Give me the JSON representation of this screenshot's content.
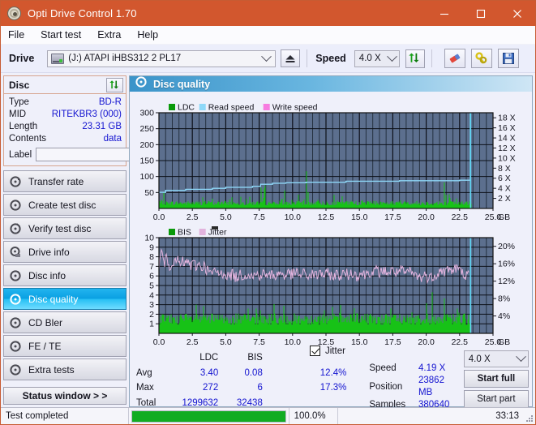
{
  "window": {
    "title": "Opti Drive Control 1.70",
    "app_icon": "disc-icon",
    "minimize": "minimize-icon",
    "maximize": "maximize-icon",
    "close": "close-icon"
  },
  "menu": [
    {
      "label": "File"
    },
    {
      "label": "Start test"
    },
    {
      "label": "Extra"
    },
    {
      "label": "Help"
    }
  ],
  "toolbar": {
    "drive_label": "Drive",
    "drive_value": "(J:)  ATAPI iHBS312  2 PL17",
    "eject": "eject-icon",
    "speed_label": "Speed",
    "speed_value": "4.0 X",
    "refresh": "refresh-icon",
    "erase": "eraser-icon",
    "tools": "wrench-icon",
    "save": "floppy-save-icon"
  },
  "disc_panel": {
    "title": "Disc",
    "refresh_icon": "refresh-icon",
    "rows": [
      {
        "key": "Type",
        "value": "BD-R"
      },
      {
        "key": "MID",
        "value": "RITEKBR3 (000)"
      },
      {
        "key": "Length",
        "value": "23.31 GB"
      },
      {
        "key": "Contents",
        "value": "data"
      }
    ],
    "label_key": "Label",
    "label_value": "",
    "label_placeholder": "",
    "label_button_icon": "disc-icon"
  },
  "nav": {
    "items": [
      {
        "label": "Transfer rate",
        "icon": "disc-arrow-icon",
        "active": false
      },
      {
        "label": "Create test disc",
        "icon": "disc-icon",
        "active": false
      },
      {
        "label": "Verify test disc",
        "icon": "disc-check-icon",
        "active": false
      },
      {
        "label": "Drive info",
        "icon": "drive-icon",
        "active": false
      },
      {
        "label": "Disc info",
        "icon": "disc-info-icon",
        "active": false
      },
      {
        "label": "Disc quality",
        "icon": "disc-quality-icon",
        "active": true
      },
      {
        "label": "CD Bler",
        "icon": "disc-bler-icon",
        "active": false
      },
      {
        "label": "FE / TE",
        "icon": "disc-fete-icon",
        "active": false
      },
      {
        "label": "Extra tests",
        "icon": "disc-extra-icon",
        "active": false
      }
    ],
    "status_window_button": "Status window > >"
  },
  "panel": {
    "icon": "disc-quality-icon",
    "title": "Disc quality"
  },
  "chart_data": [
    {
      "type": "line",
      "name": "top-chart",
      "title": "",
      "legend": [
        {
          "label": "LDC",
          "color": "#0a9a0a"
        },
        {
          "label": "Read speed",
          "color": "#8ed8f8"
        },
        {
          "label": "Write speed",
          "color": "#f77ce0"
        }
      ],
      "legend_position": "top-left",
      "xlabel": "GB",
      "x_ticks": [
        "0.0",
        "2.5",
        "5.0",
        "7.5",
        "10.0",
        "12.5",
        "15.0",
        "17.5",
        "20.0",
        "22.5",
        "25.0"
      ],
      "xlim": [
        0,
        25
      ],
      "ylabel_left": "LDC",
      "y_ticks_left": [
        "300",
        "250",
        "200",
        "150",
        "100",
        "50"
      ],
      "ylim_left": [
        0,
        300
      ],
      "ylabel_right": "Speed",
      "y_ticks_right": [
        "18 X",
        "16 X",
        "14 X",
        "12 X",
        "10 X",
        "8 X",
        "6 X",
        "4 X",
        "2 X"
      ],
      "ylim_right": [
        0,
        19
      ],
      "grid": true,
      "series": [
        {
          "name": "LDC",
          "color": "#17c217",
          "kind": "spikes",
          "baseline": 18,
          "x": [
            0.0,
            0.3,
            0.6,
            0.9,
            1.2,
            1.5,
            1.8,
            2.0,
            2.1,
            2.3,
            2.5,
            2.6,
            2.8,
            3.0,
            3.3,
            3.6,
            3.9,
            4.0,
            4.2,
            4.5,
            4.8,
            5.0,
            5.2,
            5.5,
            5.7,
            5.8,
            6.0,
            6.3,
            6.6,
            6.9,
            7.2,
            7.5,
            7.8,
            8.0,
            8.2,
            8.4,
            8.6,
            8.9,
            9.2,
            9.4,
            9.6,
            9.8,
            10.0,
            10.3,
            10.6,
            10.9,
            11.2,
            11.5,
            11.7,
            11.8,
            12.0,
            12.3,
            12.6,
            12.9,
            13.2,
            13.5,
            13.8,
            14.1,
            14.4,
            14.7,
            15.0,
            15.3,
            15.6,
            15.9,
            16.2,
            16.5,
            16.8,
            17.1,
            17.4,
            17.7,
            18.0,
            18.3,
            18.6,
            18.9,
            19.2,
            19.5,
            19.8,
            20.1,
            20.4,
            20.7,
            21.0,
            21.2,
            21.4,
            21.5,
            21.7,
            21.9,
            22.1,
            22.3,
            22.5,
            22.7,
            22.9,
            23.1,
            23.3
          ],
          "y": [
            22,
            55,
            30,
            26,
            40,
            30,
            100,
            78,
            34,
            80,
            28,
            36,
            30,
            124,
            30,
            34,
            28,
            55,
            26,
            40,
            30,
            50,
            28,
            152,
            44,
            36,
            30,
            44,
            28,
            40,
            26,
            72,
            60,
            188,
            40,
            60,
            34,
            50,
            40,
            176,
            50,
            36,
            40,
            58,
            30,
            44,
            172,
            68,
            40,
            36,
            44,
            30,
            52,
            36,
            44,
            30,
            40,
            34,
            46,
            30,
            38,
            44,
            30,
            40,
            36,
            30,
            44,
            56,
            40,
            104,
            60,
            70,
            44,
            50,
            30,
            40,
            66,
            44,
            90,
            120,
            168,
            130,
            200,
            150,
            96,
            70,
            120,
            56,
            160,
            90,
            60,
            40,
            120
          ]
        },
        {
          "name": "Read speed",
          "color": "#8ed8f8",
          "kind": "step",
          "x": [
            0.0,
            0.5,
            1.0,
            2.0,
            3.0,
            4.0,
            5.0,
            6.0,
            7.0,
            7.6,
            8.5,
            9.5,
            11.0,
            12.5,
            14.0,
            15.5,
            17.0,
            18.0,
            19.5,
            21.0,
            22.5,
            23.3,
            23.3
          ],
          "y": [
            3.2,
            3.6,
            3.6,
            3.8,
            3.8,
            4.0,
            4.2,
            4.2,
            4.4,
            4.8,
            5.0,
            5.1,
            5.2,
            5.2,
            5.4,
            5.4,
            5.4,
            5.5,
            5.5,
            5.5,
            5.6,
            5.6,
            19.0
          ]
        }
      ]
    },
    {
      "type": "line",
      "name": "bottom-chart",
      "title": "",
      "legend": [
        {
          "label": "BIS",
          "color": "#0a9a0a"
        },
        {
          "label": "Jitter",
          "color": "#e2b3dd"
        }
      ],
      "legend_position": "top-left",
      "xlabel": "GB",
      "x_ticks": [
        "0.0",
        "2.5",
        "5.0",
        "7.5",
        "10.0",
        "12.5",
        "15.0",
        "17.5",
        "20.0",
        "22.5",
        "25.0"
      ],
      "xlim": [
        0,
        25
      ],
      "ylabel_left": "BIS",
      "y_ticks_left": [
        "10",
        "9",
        "8",
        "7",
        "6",
        "5",
        "4",
        "3",
        "2",
        "1"
      ],
      "ylim_left": [
        0,
        10
      ],
      "ylabel_right": "Jitter",
      "y_ticks_right": [
        "20%",
        "16%",
        "12%",
        "8%",
        "4%"
      ],
      "ylim_right": [
        0,
        22
      ],
      "grid": true,
      "series": [
        {
          "name": "BIS",
          "color": "#17c217",
          "kind": "spikes",
          "baseline": 1.6,
          "x": [
            0.0,
            0.2,
            0.4,
            0.6,
            0.8,
            1.0,
            1.2,
            1.4,
            1.6,
            1.8,
            2.0,
            2.2,
            2.4,
            2.6,
            2.8,
            3.0,
            3.2,
            3.4,
            3.6,
            3.8,
            4.0,
            4.2,
            4.4,
            4.6,
            4.8,
            5.0,
            5.2,
            5.4,
            5.6,
            5.8,
            6.0,
            6.2,
            6.4,
            6.6,
            6.8,
            7.0,
            7.2,
            7.4,
            7.6,
            7.8,
            8.0,
            8.2,
            8.4,
            8.6,
            8.8,
            9.0,
            9.2,
            9.4,
            9.6,
            9.8,
            10.0,
            10.3,
            10.6,
            10.9,
            11.2,
            11.5,
            11.8,
            12.1,
            12.4,
            12.7,
            13.0,
            13.3,
            13.6,
            13.9,
            14.2,
            14.5,
            14.8,
            15.1,
            15.4,
            15.7,
            16.0,
            16.3,
            16.6,
            16.9,
            17.2,
            17.5,
            17.8,
            18.1,
            18.4,
            18.7,
            19.0,
            19.3,
            19.6,
            19.9,
            20.2,
            20.5,
            20.8,
            21.1,
            21.4,
            21.7,
            22.0,
            22.3,
            22.6,
            22.9,
            23.2
          ],
          "y": [
            2.2,
            1.9,
            1.4,
            2.8,
            2.6,
            1.9,
            2.4,
            3.0,
            2.2,
            4.1,
            2.6,
            3.0,
            2.2,
            2.6,
            3.0,
            2.0,
            2.4,
            3.0,
            2.2,
            2.6,
            2.2,
            2.4,
            3.0,
            2.2,
            2.8,
            3.0,
            2.4,
            3.2,
            5.1,
            3.3,
            2.9,
            2.6,
            3.0,
            2.4,
            2.8,
            2.6,
            2.2,
            3.0,
            2.4,
            2.8,
            2.2,
            4.1,
            2.6,
            3.2,
            2.4,
            2.6,
            2.2,
            3.0,
            2.6,
            2.4,
            2.8,
            2.2,
            3.0,
            2.6,
            2.4,
            2.8,
            2.2,
            3.0,
            2.4,
            2.6,
            2.8,
            2.2,
            3.0,
            2.6,
            2.4,
            2.8,
            5.1,
            2.2,
            2.6,
            3.0,
            2.4,
            2.8,
            3.3,
            2.6,
            3.0,
            2.4,
            2.8,
            2.6,
            3.0,
            3.4,
            3.0,
            2.6,
            3.0,
            2.8,
            3.4,
            4.3,
            3.2,
            4.9,
            3.6,
            5.0,
            3.4,
            4.9,
            3.4,
            3.0,
            2.8
          ]
        },
        {
          "name": "Jitter",
          "color": "#e2b3dd",
          "kind": "noisy",
          "x": [
            0.0,
            0.2,
            0.4,
            0.6,
            0.8,
            1.0,
            1.2,
            1.4,
            1.6,
            1.8,
            2.0,
            2.2,
            2.4,
            2.6,
            2.8,
            3.0,
            3.2,
            3.4,
            3.6,
            3.8,
            4.0,
            4.3,
            4.6,
            4.9,
            5.2,
            5.5,
            5.8,
            6.1,
            6.4,
            6.7,
            7.0,
            7.3,
            7.6,
            7.9,
            8.2,
            8.5,
            8.8,
            9.1,
            9.4,
            9.7,
            10.0,
            10.3,
            10.6,
            10.9,
            11.2,
            11.5,
            11.8,
            12.1,
            12.4,
            12.7,
            13.0,
            13.3,
            13.6,
            13.9,
            14.2,
            14.5,
            14.8,
            15.1,
            15.4,
            15.7,
            16.0,
            16.3,
            16.6,
            16.9,
            17.2,
            17.5,
            17.8,
            18.1,
            18.4,
            18.7,
            19.0,
            19.3,
            19.6,
            19.9,
            20.2,
            20.5,
            20.8,
            21.1,
            21.4,
            21.7,
            22.0,
            22.3,
            22.6,
            22.9,
            23.2
          ],
          "y": [
            6.9,
            8.6,
            7.3,
            7.9,
            7.0,
            7.6,
            7.2,
            7.8,
            7.0,
            7.5,
            7.2,
            7.6,
            7.0,
            7.3,
            7.0,
            7.2,
            6.9,
            7.1,
            6.6,
            6.4,
            6.2,
            6.5,
            6.1,
            6.4,
            5.9,
            6.2,
            5.8,
            6.2,
            6.0,
            6.3,
            5.9,
            6.2,
            6.0,
            6.3,
            5.9,
            6.2,
            6.0,
            6.4,
            6.0,
            6.3,
            6.1,
            6.4,
            6.0,
            6.3,
            5.9,
            6.2,
            6.0,
            6.4,
            6.0,
            6.3,
            5.9,
            6.2,
            6.0,
            6.3,
            6.1,
            6.4,
            6.0,
            6.3,
            6.1,
            6.5,
            6.2,
            6.6,
            6.3,
            6.6,
            6.3,
            6.6,
            6.3,
            6.6,
            6.2,
            6.5,
            6.2,
            6.0,
            5.8,
            6.1,
            5.7,
            6.0,
            6.2,
            6.6,
            6.4,
            6.8,
            6.5,
            6.9,
            6.4,
            6.2,
            6.0
          ]
        }
      ]
    }
  ],
  "stats": {
    "col_headers": [
      "",
      "LDC",
      "BIS",
      "",
      "Jitter"
    ],
    "jitter_checkbox_checked": true,
    "jitter_label": "Jitter",
    "rows": [
      {
        "label": "Avg",
        "ldc": "3.40",
        "bis": "0.08",
        "jitter": "12.4%"
      },
      {
        "label": "Max",
        "ldc": "272",
        "bis": "6",
        "jitter": "17.3%"
      },
      {
        "label": "Total",
        "ldc": "1299632",
        "bis": "32438",
        "jitter": ""
      }
    ],
    "right": [
      {
        "label": "Speed",
        "value": "4.19 X"
      },
      {
        "label": "Position",
        "value": "23862 MB"
      },
      {
        "label": "Samples",
        "value": "380640"
      }
    ],
    "speed_select_value": "4.0 X",
    "start_full_button": "Start full",
    "start_part_button": "Start part"
  },
  "statusbar": {
    "message": "Test completed",
    "progress_percent_label": "100.0%",
    "progress_value": 100,
    "elapsed": "33:13"
  },
  "colors": {
    "titlebar": "#d2572e",
    "accent_blue": "#1414d0",
    "chart_bg": "#5c6f8e",
    "grid": "#1d2430",
    "ldc_green": "#17c217",
    "read_speed": "#8ed8f8",
    "write_speed": "#f77ce0",
    "jitter_pink": "#e2b3dd",
    "progress_green": "#11ac22",
    "nav_active": "#16a8e8"
  }
}
